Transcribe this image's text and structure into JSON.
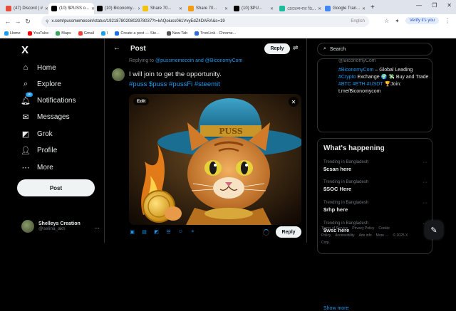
{
  "browser": {
    "tabs": [
      {
        "label": "(47) Discord | #",
        "color": "#e74c3c"
      },
      {
        "label": "(10) $PUSS o...",
        "color": "#000000",
        "active": true
      },
      {
        "label": "(10) Biconomy...",
        "color": "#000000"
      },
      {
        "label": "Share 70...",
        "color": "#f1c40f"
      },
      {
        "label": "Share 70...",
        "color": "#f39c12"
      },
      {
        "label": "(10) $PU...",
        "color": "#000000"
      },
      {
        "label": "ডেভেলপার ডি...",
        "color": "#1abc9c"
      },
      {
        "label": "Google Tran...",
        "color": "#4285f4"
      }
    ],
    "new_tab": "+",
    "window_controls": [
      "—",
      "❐",
      "✕"
    ],
    "url": "x.com/pussmemecoin/status/1921878020802978037?t=kAQoiucs061VvyEdZ4DARA&s=19",
    "translate_hint": "English",
    "verify_label": "Verify it's you",
    "bookmarks": [
      {
        "label": "Home",
        "color": "#1d9bf0"
      },
      {
        "label": "YouTube",
        "color": "#ff0000"
      },
      {
        "label": "Maps",
        "color": "#34a853"
      },
      {
        "label": "Gmail",
        "color": "#ea4335"
      },
      {
        "label": "l",
        "color": "#1d9bf0"
      },
      {
        "label": "Create a post — Ste...",
        "color": "#1a73e8"
      },
      {
        "label": "New Tab",
        "color": "#555555"
      },
      {
        "label": "TronLink - Chrome...",
        "color": "#2f6fdb"
      }
    ]
  },
  "nav": {
    "logo": "X",
    "items": [
      {
        "label": "Home",
        "icon": "home-icon",
        "glyph": "⌂"
      },
      {
        "label": "Explore",
        "icon": "search-icon",
        "glyph": "⌕"
      },
      {
        "label": "Notifications",
        "icon": "bell-icon",
        "glyph": "🔔︎",
        "badge": "10"
      },
      {
        "label": "Messages",
        "icon": "mail-icon",
        "glyph": "✉"
      },
      {
        "label": "Grok",
        "icon": "grok-icon",
        "glyph": "◩"
      },
      {
        "label": "Profile",
        "icon": "person-icon",
        "glyph": "👤︎"
      },
      {
        "label": "More",
        "icon": "more-icon",
        "glyph": "⋯"
      }
    ],
    "post_button": "Post",
    "profile": {
      "name": "Shelleys Creation",
      "handle": "@selina_akh",
      "more": "···"
    }
  },
  "main": {
    "title": "Post",
    "reply_button_top": "Reply",
    "replying_to_prefix": "Replying to",
    "replying_to_users": "@pussmemecoin and @BiconomyCom",
    "text": "I will join to get the opportunity.",
    "hashtags": "#puss $puss #pussFi #steemit",
    "media_edit": "Edit",
    "media_close": "✕",
    "reply_button": "Reply",
    "toolbar_icons": [
      "image-icon",
      "gif-icon",
      "grok-icon",
      "poll-icon",
      "emoji-icon",
      "location-icon"
    ]
  },
  "right": {
    "search_placeholder": "Search",
    "profile_card": {
      "handle": "@BiconomyCom",
      "bio_prefix": "#BiconomyCom",
      "bio_1": "– Global Leading",
      "bio_2_tag": "#Crypto",
      "bio_2": "Exchange 🌍 💸 Buy and",
      "bio_3": "Trade",
      "bio_3_tags": "#BTC #ETH #USDT",
      "bio_3_end": "🏆Join:",
      "bio_link": "t.me/Biconomycom"
    },
    "whats_happening": "What's happening",
    "trends": [
      {
        "meta": "Trending in Bangladesh",
        "name": "$csan here"
      },
      {
        "meta": "Trending in Bangladesh",
        "name": "$SOC Here"
      },
      {
        "meta": "Trending in Bangladesh",
        "name": "$rhp here"
      },
      {
        "meta": "Trending in Bangladesh",
        "name": "$wsc here"
      }
    ],
    "show_more": "Show more",
    "footer": [
      "Terms of Service",
      "Privacy Policy",
      "Cookie Policy",
      "Accessibility",
      "Ads info",
      "More ···",
      "© 2025 X Corp."
    ]
  }
}
